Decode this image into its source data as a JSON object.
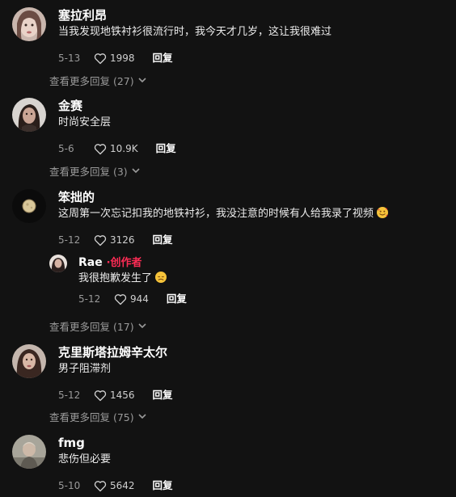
{
  "comments": [
    {
      "name": "塞拉利昂",
      "text": "当我发现地铁衬衫很流行时，我今天才几岁，这让我很难过",
      "date": "5-13",
      "likes": "1998",
      "reply_label": "回复",
      "more_replies": "查看更多回复 (27)"
    },
    {
      "name": "金赛",
      "text": "时尚安全层",
      "date": "5-6",
      "likes": "10.9K",
      "reply_label": "回复",
      "more_replies": "查看更多回复 (3)"
    },
    {
      "name": "笨拙的",
      "text": "这周第一次忘记扣我的地铁衬衫，我没注意的时候有人给我录了视频",
      "emoji": "smiling-face-with-hearts",
      "date": "5-12",
      "likes": "3126",
      "reply_label": "回复",
      "reply": {
        "name": "Rae",
        "creator_label": "·创作者",
        "text": "我很抱歉发生了",
        "emoji": "disappointed-face",
        "date": "5-12",
        "likes": "944",
        "reply_label": "回复"
      },
      "more_replies": "查看更多回复 (17)"
    },
    {
      "name": "克里斯塔拉姆辛太尔",
      "text": "男子阻滞剂",
      "date": "5-12",
      "likes": "1456",
      "reply_label": "回复",
      "more_replies": "查看更多回复 (75)"
    },
    {
      "name": "fmg",
      "text": "悲伤但必要",
      "date": "5-10",
      "likes": "5642",
      "reply_label": "回复"
    }
  ],
  "colors": {
    "background": "#121212",
    "creator": "#fe2c55",
    "muted": "#9a9a9a"
  }
}
